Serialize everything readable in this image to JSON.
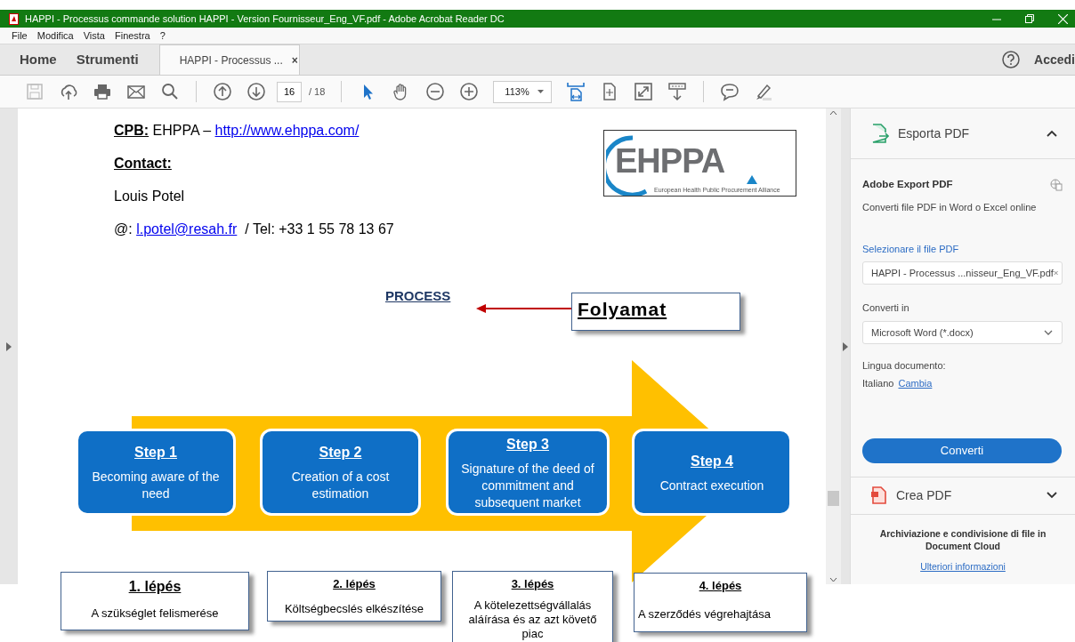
{
  "window": {
    "title": "HAPPI - Processus commande solution HAPPI - Version Fournisseur_Eng_VF.pdf - Adobe Acrobat Reader DC"
  },
  "menu": [
    "File",
    "Modifica",
    "Vista",
    "Finestra",
    "?"
  ],
  "tabs": [
    {
      "label": "Home",
      "kind": "nav",
      "selected": false
    },
    {
      "label": "Strumenti",
      "kind": "nav",
      "selected": false
    },
    {
      "label": "HAPPI - Processus ...",
      "kind": "document",
      "selected": true,
      "close": "×"
    }
  ],
  "account": {
    "label": "Accedi"
  },
  "toolbar": {
    "page": "16",
    "total": "/ 18",
    "zoom": "113%"
  },
  "document": {
    "cpb_label": "CPB:",
    "cpb_text": "EHPPA –",
    "cpb_link": "http://www.ehppa.com/",
    "contact_label": "Contact:",
    "name": "Louis Potel",
    "email_prefix": "@:",
    "email": "l.potel@resah.fr",
    "phone": "/ Tel: +33 1 55 78 13 67",
    "logo": {
      "name": "EHPPA",
      "tagline": "European Health Public Procurement Alliance"
    },
    "heading": "PROCESS",
    "steps": [
      {
        "title": "Step 1",
        "text": "Becoming aware of the need"
      },
      {
        "title": "Step 2",
        "text": "Creation of a cost estimation"
      },
      {
        "title": "Step 3",
        "text": "Signature of the deed of commitment and subsequent market"
      },
      {
        "title": "Step 4",
        "text": "Contract execution"
      }
    ]
  },
  "annotations": {
    "heading": "Folyamat",
    "steps": [
      {
        "title": "1. lépés",
        "text": "A szükséglet felismerése"
      },
      {
        "title": "2. lépés",
        "text": "Költségbecslés elkészítése"
      },
      {
        "title": "3. lépés",
        "text": "A kötelezettségvállalás aláírása és az azt követő piac"
      },
      {
        "title": "4. lépés",
        "text": "A szerződés végrehajtása"
      }
    ]
  },
  "panel": {
    "export": {
      "title": "Esporta PDF",
      "expanded": true,
      "service": "Adobe Export PDF",
      "description": "Converti file PDF in Word o Excel online",
      "file_label": "Selezionare il file PDF",
      "file_value": "HAPPI - Processus ...nisseur_Eng_VF.pdf",
      "convert_label": "Converti in",
      "format": "Microsoft Word (*.docx)",
      "language_label": "Lingua documento:",
      "language": "Italiano",
      "change_link": "Cambia",
      "button": "Converti"
    },
    "create": {
      "title": "Crea PDF",
      "expanded": false
    },
    "cloud_text": "Archiviazione e condivisione di file in Document Cloud",
    "more_link": "Ulteriori informazioni"
  }
}
